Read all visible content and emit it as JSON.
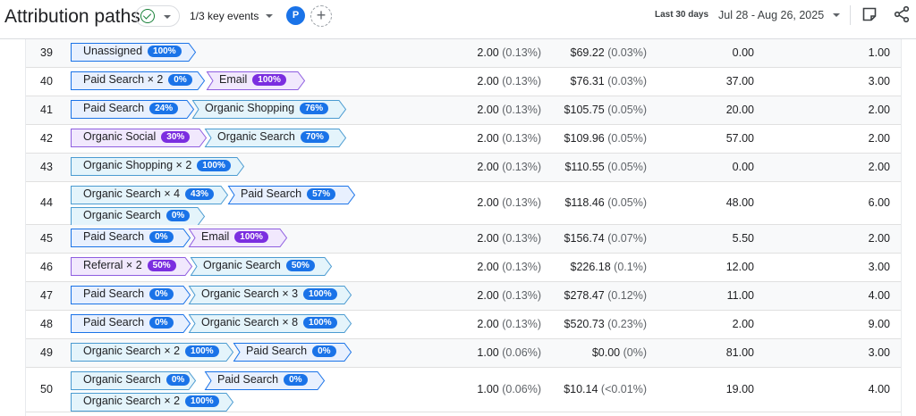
{
  "header": {
    "title": "Attribution paths",
    "key_events": "1/3 key events",
    "avatar_letter": "P",
    "add_label": "+",
    "date_label": "Last 30 days",
    "date_range": "Jul 28 - Aug 26, 2025"
  },
  "colors": {
    "paid_fill": "#e8f0fe",
    "paid_stroke": "#1a73e8",
    "organic_fill": "#e4f4fb",
    "organic_stroke": "#4a9bd1",
    "purple_fill": "#f1e8fd",
    "purple_stroke": "#8e5de0"
  },
  "rows": [
    {
      "index": "39",
      "chips": [
        {
          "label": "Unassigned",
          "badge": "100%",
          "style": "paid"
        }
      ],
      "c1": "2.00",
      "c1p": "(0.13%)",
      "c2": "$69.22",
      "c2p": "(0.03%)",
      "c3": "0.00",
      "c4": "1.00"
    },
    {
      "index": "40",
      "chips": [
        {
          "label": "Paid Search × 2",
          "badge": "0%",
          "style": "paid"
        },
        {
          "label": "Email",
          "badge": "100%",
          "style": "purple"
        }
      ],
      "c1": "2.00",
      "c1p": "(0.13%)",
      "c2": "$76.31",
      "c2p": "(0.03%)",
      "c3": "37.00",
      "c4": "3.00"
    },
    {
      "index": "41",
      "chips": [
        {
          "label": "Paid Search",
          "badge": "24%",
          "style": "paid"
        },
        {
          "label": "Organic Shopping",
          "badge": "76%",
          "style": "organic"
        }
      ],
      "c1": "2.00",
      "c1p": "(0.13%)",
      "c2": "$105.75",
      "c2p": "(0.05%)",
      "c3": "20.00",
      "c4": "2.00"
    },
    {
      "index": "42",
      "chips": [
        {
          "label": "Organic Social",
          "badge": "30%",
          "style": "purple"
        },
        {
          "label": "Organic Search",
          "badge": "70%",
          "style": "organic"
        }
      ],
      "c1": "2.00",
      "c1p": "(0.13%)",
      "c2": "$109.96",
      "c2p": "(0.05%)",
      "c3": "57.00",
      "c4": "2.00"
    },
    {
      "index": "43",
      "chips": [
        {
          "label": "Organic Shopping × 2",
          "badge": "100%",
          "style": "organic"
        }
      ],
      "c1": "2.00",
      "c1p": "(0.13%)",
      "c2": "$110.55",
      "c2p": "(0.05%)",
      "c3": "0.00",
      "c4": "2.00"
    },
    {
      "index": "44",
      "chips": [
        {
          "label": "Organic Search × 4",
          "badge": "43%",
          "style": "organic"
        },
        {
          "label": "Paid Search",
          "badge": "57%",
          "style": "paid"
        },
        {
          "label": "Organic Search",
          "badge": "0%",
          "style": "organic"
        }
      ],
      "c1": "2.00",
      "c1p": "(0.13%)",
      "c2": "$118.46",
      "c2p": "(0.05%)",
      "c3": "48.00",
      "c4": "6.00"
    },
    {
      "index": "45",
      "chips": [
        {
          "label": "Paid Search",
          "badge": "0%",
          "style": "paid"
        },
        {
          "label": "Email",
          "badge": "100%",
          "style": "purple"
        }
      ],
      "c1": "2.00",
      "c1p": "(0.13%)",
      "c2": "$156.74",
      "c2p": "(0.07%)",
      "c3": "5.50",
      "c4": "2.00"
    },
    {
      "index": "46",
      "chips": [
        {
          "label": "Referral × 2",
          "badge": "50%",
          "style": "purple"
        },
        {
          "label": "Organic Search",
          "badge": "50%",
          "style": "organic"
        }
      ],
      "c1": "2.00",
      "c1p": "(0.13%)",
      "c2": "$226.18",
      "c2p": "(0.1%)",
      "c3": "12.00",
      "c4": "3.00"
    },
    {
      "index": "47",
      "chips": [
        {
          "label": "Paid Search",
          "badge": "0%",
          "style": "paid"
        },
        {
          "label": "Organic Search × 3",
          "badge": "100%",
          "style": "organic"
        }
      ],
      "c1": "2.00",
      "c1p": "(0.13%)",
      "c2": "$278.47",
      "c2p": "(0.12%)",
      "c3": "11.00",
      "c4": "4.00"
    },
    {
      "index": "48",
      "chips": [
        {
          "label": "Paid Search",
          "badge": "0%",
          "style": "paid"
        },
        {
          "label": "Organic Search × 8",
          "badge": "100%",
          "style": "organic"
        }
      ],
      "c1": "2.00",
      "c1p": "(0.13%)",
      "c2": "$520.73",
      "c2p": "(0.23%)",
      "c3": "2.00",
      "c4": "9.00"
    },
    {
      "index": "49",
      "chips": [
        {
          "label": "Organic Search × 2",
          "badge": "100%",
          "style": "organic"
        },
        {
          "label": "Paid Search",
          "badge": "0%",
          "style": "paid"
        }
      ],
      "c1": "1.00",
      "c1p": "(0.06%)",
      "c2": "$0.00",
      "c2p": "(0%)",
      "c3": "81.00",
      "c4": "3.00"
    },
    {
      "index": "50",
      "chips": [
        {
          "label": "Organic Search",
          "badge": "0%",
          "style": "organic"
        },
        {
          "label": "Paid Search",
          "badge": "0%",
          "style": "paid"
        },
        {
          "label": "Organic Search × 2",
          "badge": "100%",
          "style": "organic"
        }
      ],
      "c1": "1.00",
      "c1p": "(0.06%)",
      "c2": "$10.14",
      "c2p": "(<0.01%)",
      "c3": "19.00",
      "c4": "4.00"
    }
  ]
}
